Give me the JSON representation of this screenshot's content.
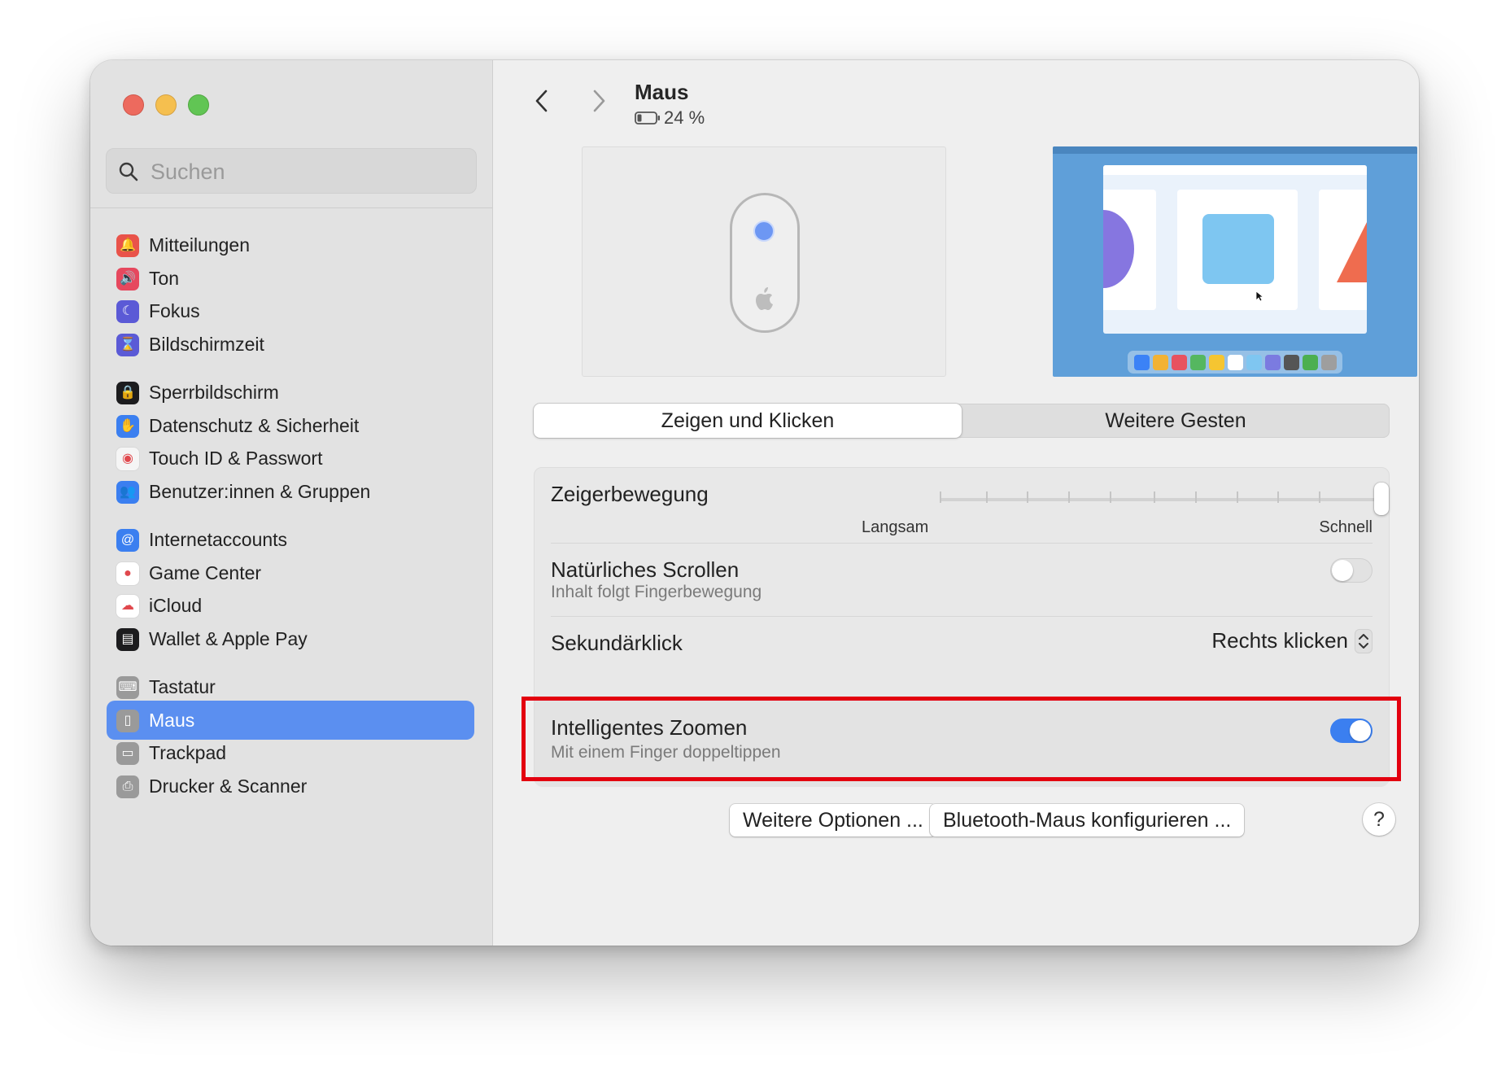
{
  "sidebar": {
    "search_placeholder": "Suchen",
    "groups": [
      [
        {
          "label": "Mitteilungen",
          "icon": "bell-icon",
          "color": "#e9534a",
          "glyph": "🔔"
        },
        {
          "label": "Ton",
          "icon": "speaker-icon",
          "color": "#e6485e",
          "glyph": "🔊"
        },
        {
          "label": "Fokus",
          "icon": "moon-icon",
          "color": "#5b5ad6",
          "glyph": "☾"
        },
        {
          "label": "Bildschirmzeit",
          "icon": "hourglass-icon",
          "color": "#5b5ad6",
          "glyph": "⌛"
        }
      ],
      [
        {
          "label": "Sperrbildschirm",
          "icon": "lock-icon",
          "color": "#1c1c1e",
          "glyph": "🔒"
        },
        {
          "label": "Datenschutz & Sicherheit",
          "icon": "hand-icon",
          "color": "#3b7ff0",
          "glyph": "✋"
        },
        {
          "label": "Touch ID & Passwort",
          "icon": "fingerprint-icon",
          "color": "#f5f5f5",
          "glyph": "◉"
        },
        {
          "label": "Benutzer:innen & Gruppen",
          "icon": "users-icon",
          "color": "#3b7ff0",
          "glyph": "👥"
        }
      ],
      [
        {
          "label": "Internetaccounts",
          "icon": "at-icon",
          "color": "#3b7ff0",
          "glyph": "@"
        },
        {
          "label": "Game Center",
          "icon": "game-center-icon",
          "color": "#ffffff",
          "glyph": "●"
        },
        {
          "label": "iCloud",
          "icon": "cloud-icon",
          "color": "#ffffff",
          "glyph": "☁"
        },
        {
          "label": "Wallet & Apple Pay",
          "icon": "wallet-icon",
          "color": "#1c1c1e",
          "glyph": "▤"
        }
      ],
      [
        {
          "label": "Tastatur",
          "icon": "keyboard-icon",
          "color": "#9a9a9a",
          "glyph": "⌨"
        },
        {
          "label": "Maus",
          "icon": "mouse-icon",
          "color": "#9a9a9a",
          "glyph": "▯",
          "active": true
        },
        {
          "label": "Trackpad",
          "icon": "trackpad-icon",
          "color": "#9a9a9a",
          "glyph": "▭"
        },
        {
          "label": "Drucker & Scanner",
          "icon": "printer-icon",
          "color": "#9a9a9a",
          "glyph": "⎙"
        }
      ]
    ]
  },
  "header": {
    "title": "Maus",
    "battery": "24 %"
  },
  "tabs": [
    "Zeigen und Klicken",
    "Weitere Gesten"
  ],
  "settings": {
    "tracking_speed": {
      "label": "Zeigerbewegung",
      "min_label": "Langsam",
      "max_label": "Schnell"
    },
    "natural_scrolling": {
      "label": "Natürliches Scrollen",
      "sub": "Inhalt folgt Fingerbewegung",
      "on": false
    },
    "secondary_click": {
      "label": "Sekundärklick",
      "value": "Rechts klicken"
    },
    "smart_zoom": {
      "label": "Intelligentes Zoomen",
      "sub": "Mit einem Finger doppeltippen",
      "on": true
    }
  },
  "buttons": {
    "more_options": "Weitere Optionen ...",
    "bluetooth": "Bluetooth-Maus konfigurieren ...",
    "help": "?"
  },
  "colors": {
    "accent": "#3b7ff0",
    "sidebar_selected": "#5b8ff0",
    "highlight": "#e3000f"
  },
  "dock_colors": [
    "#3b82f6",
    "#f2b233",
    "#e8525f",
    "#55b760",
    "#f5c531",
    "#ffffff",
    "#7fc6f1",
    "#7b7be0",
    "#555555",
    "#4caf50",
    "#9e9e9e"
  ]
}
